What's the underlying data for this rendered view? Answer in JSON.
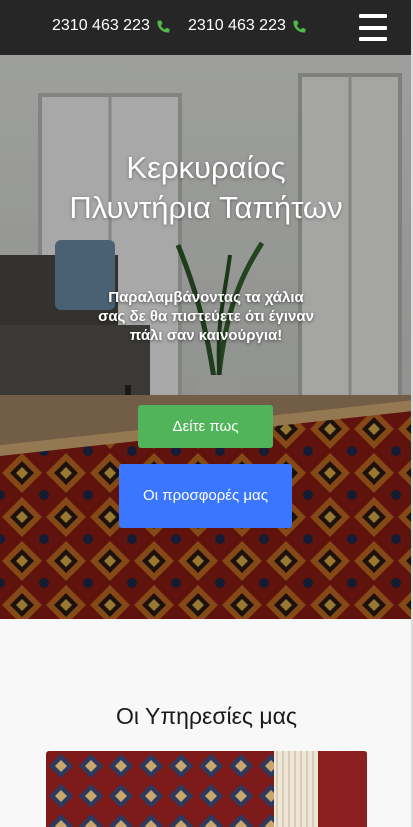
{
  "header": {
    "phone_1": "2310 463 223",
    "phone_2": "2310 463 223",
    "phone_icon": "phone-icon",
    "menu_icon": "hamburger-menu-icon"
  },
  "hero": {
    "title": "Κερκυραίος Πλυντήρια Ταπήτων",
    "subtitle": "Παραλαμβάνοντας τα χάλια σας δε θα πιστεύετε ότι έγιναν πάλι σαν καινούργια!",
    "primary_button": "Δείτε πως",
    "secondary_button": "Οι προσφορές μας"
  },
  "services": {
    "heading": "Οι Υπηρεσίες μας"
  },
  "colors": {
    "topbar": "#262626",
    "phone_icon": "#4fb848",
    "button_green": "#52b45a",
    "button_blue": "#3a76ff"
  }
}
